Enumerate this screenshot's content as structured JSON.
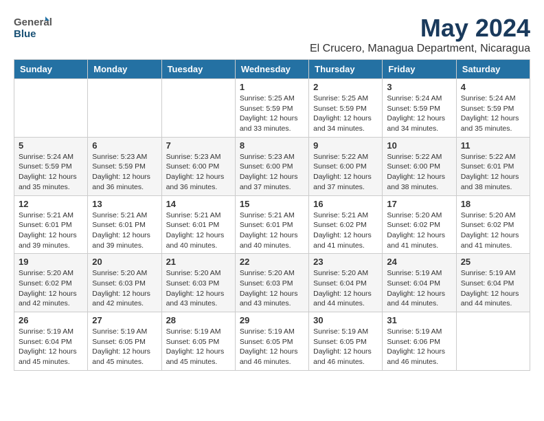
{
  "header": {
    "logo_general": "General",
    "logo_blue": "Blue",
    "month_title": "May 2024",
    "subtitle": "El Crucero, Managua Department, Nicaragua"
  },
  "weekdays": [
    "Sunday",
    "Monday",
    "Tuesday",
    "Wednesday",
    "Thursday",
    "Friday",
    "Saturday"
  ],
  "weeks": [
    [
      {
        "day": "",
        "info": ""
      },
      {
        "day": "",
        "info": ""
      },
      {
        "day": "",
        "info": ""
      },
      {
        "day": "1",
        "info": "Sunrise: 5:25 AM\nSunset: 5:59 PM\nDaylight: 12 hours\nand 33 minutes."
      },
      {
        "day": "2",
        "info": "Sunrise: 5:25 AM\nSunset: 5:59 PM\nDaylight: 12 hours\nand 34 minutes."
      },
      {
        "day": "3",
        "info": "Sunrise: 5:24 AM\nSunset: 5:59 PM\nDaylight: 12 hours\nand 34 minutes."
      },
      {
        "day": "4",
        "info": "Sunrise: 5:24 AM\nSunset: 5:59 PM\nDaylight: 12 hours\nand 35 minutes."
      }
    ],
    [
      {
        "day": "5",
        "info": "Sunrise: 5:24 AM\nSunset: 5:59 PM\nDaylight: 12 hours\nand 35 minutes."
      },
      {
        "day": "6",
        "info": "Sunrise: 5:23 AM\nSunset: 5:59 PM\nDaylight: 12 hours\nand 36 minutes."
      },
      {
        "day": "7",
        "info": "Sunrise: 5:23 AM\nSunset: 6:00 PM\nDaylight: 12 hours\nand 36 minutes."
      },
      {
        "day": "8",
        "info": "Sunrise: 5:23 AM\nSunset: 6:00 PM\nDaylight: 12 hours\nand 37 minutes."
      },
      {
        "day": "9",
        "info": "Sunrise: 5:22 AM\nSunset: 6:00 PM\nDaylight: 12 hours\nand 37 minutes."
      },
      {
        "day": "10",
        "info": "Sunrise: 5:22 AM\nSunset: 6:00 PM\nDaylight: 12 hours\nand 38 minutes."
      },
      {
        "day": "11",
        "info": "Sunrise: 5:22 AM\nSunset: 6:01 PM\nDaylight: 12 hours\nand 38 minutes."
      }
    ],
    [
      {
        "day": "12",
        "info": "Sunrise: 5:21 AM\nSunset: 6:01 PM\nDaylight: 12 hours\nand 39 minutes."
      },
      {
        "day": "13",
        "info": "Sunrise: 5:21 AM\nSunset: 6:01 PM\nDaylight: 12 hours\nand 39 minutes."
      },
      {
        "day": "14",
        "info": "Sunrise: 5:21 AM\nSunset: 6:01 PM\nDaylight: 12 hours\nand 40 minutes."
      },
      {
        "day": "15",
        "info": "Sunrise: 5:21 AM\nSunset: 6:01 PM\nDaylight: 12 hours\nand 40 minutes."
      },
      {
        "day": "16",
        "info": "Sunrise: 5:21 AM\nSunset: 6:02 PM\nDaylight: 12 hours\nand 41 minutes."
      },
      {
        "day": "17",
        "info": "Sunrise: 5:20 AM\nSunset: 6:02 PM\nDaylight: 12 hours\nand 41 minutes."
      },
      {
        "day": "18",
        "info": "Sunrise: 5:20 AM\nSunset: 6:02 PM\nDaylight: 12 hours\nand 41 minutes."
      }
    ],
    [
      {
        "day": "19",
        "info": "Sunrise: 5:20 AM\nSunset: 6:02 PM\nDaylight: 12 hours\nand 42 minutes."
      },
      {
        "day": "20",
        "info": "Sunrise: 5:20 AM\nSunset: 6:03 PM\nDaylight: 12 hours\nand 42 minutes."
      },
      {
        "day": "21",
        "info": "Sunrise: 5:20 AM\nSunset: 6:03 PM\nDaylight: 12 hours\nand 43 minutes."
      },
      {
        "day": "22",
        "info": "Sunrise: 5:20 AM\nSunset: 6:03 PM\nDaylight: 12 hours\nand 43 minutes."
      },
      {
        "day": "23",
        "info": "Sunrise: 5:20 AM\nSunset: 6:04 PM\nDaylight: 12 hours\nand 44 minutes."
      },
      {
        "day": "24",
        "info": "Sunrise: 5:19 AM\nSunset: 6:04 PM\nDaylight: 12 hours\nand 44 minutes."
      },
      {
        "day": "25",
        "info": "Sunrise: 5:19 AM\nSunset: 6:04 PM\nDaylight: 12 hours\nand 44 minutes."
      }
    ],
    [
      {
        "day": "26",
        "info": "Sunrise: 5:19 AM\nSunset: 6:04 PM\nDaylight: 12 hours\nand 45 minutes."
      },
      {
        "day": "27",
        "info": "Sunrise: 5:19 AM\nSunset: 6:05 PM\nDaylight: 12 hours\nand 45 minutes."
      },
      {
        "day": "28",
        "info": "Sunrise: 5:19 AM\nSunset: 6:05 PM\nDaylight: 12 hours\nand 45 minutes."
      },
      {
        "day": "29",
        "info": "Sunrise: 5:19 AM\nSunset: 6:05 PM\nDaylight: 12 hours\nand 46 minutes."
      },
      {
        "day": "30",
        "info": "Sunrise: 5:19 AM\nSunset: 6:05 PM\nDaylight: 12 hours\nand 46 minutes."
      },
      {
        "day": "31",
        "info": "Sunrise: 5:19 AM\nSunset: 6:06 PM\nDaylight: 12 hours\nand 46 minutes."
      },
      {
        "day": "",
        "info": ""
      }
    ]
  ]
}
